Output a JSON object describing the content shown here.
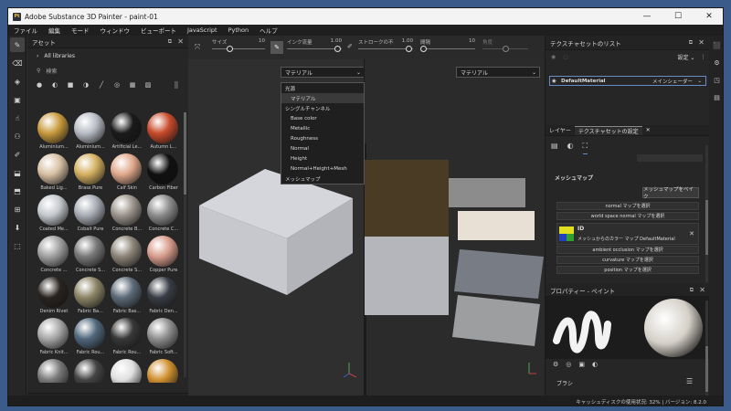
{
  "window": {
    "title": "Adobe Substance 3D Painter - paint-01",
    "app_icon": "Pt",
    "controls": [
      "—",
      "☐",
      "✕"
    ]
  },
  "menu": [
    "ファイル",
    "編集",
    "モード",
    "ウィンドウ",
    "ビューポート",
    "JavaScript",
    "Python",
    "ヘルプ"
  ],
  "toolbar": {
    "size_label": "サイズ",
    "size_value": "10",
    "flow_label": "インク流量",
    "flow_value": "1.00",
    "stroke_label": "ストロークの不",
    "stroke_value": "1.00",
    "spacing_label": "間隔",
    "spacing_value": "10",
    "angle_label": "角度",
    "brush_icon": "brush-icon"
  },
  "assets": {
    "title": "アセット",
    "library": "All libraries",
    "search_placeholder": "検索",
    "materials": [
      {
        "name": "Aluminium...",
        "color": "#c89a3c"
      },
      {
        "name": "Aluminium...",
        "color": "#b8bcc4"
      },
      {
        "name": "Artificial Le...",
        "color": "#1a1a1a"
      },
      {
        "name": "Autumn L...",
        "color": "#c84a2a"
      },
      {
        "name": "Baked Lig...",
        "color": "#d8c0a4"
      },
      {
        "name": "Brass Pure",
        "color": "#d4b060"
      },
      {
        "name": "Calf Skin",
        "color": "#e0a88c"
      },
      {
        "name": "Carbon Fiber",
        "color": "#101010"
      },
      {
        "name": "Coated Me...",
        "color": "#c4c8cc"
      },
      {
        "name": "Cobalt Pure",
        "color": "#a8acb4"
      },
      {
        "name": "Concrete B...",
        "color": "#9c948c"
      },
      {
        "name": "Concrete C...",
        "color": "#8c8c8c"
      },
      {
        "name": "Concrete ...",
        "color": "#a0a0a0"
      },
      {
        "name": "Concrete S...",
        "color": "#787878"
      },
      {
        "name": "Concrete S...",
        "color": "#8c8478"
      },
      {
        "name": "Copper Pure",
        "color": "#d89c8c"
      },
      {
        "name": "Denim Rivet",
        "color": "#2a2420"
      },
      {
        "name": "Fabric Ba...",
        "color": "#8c8466"
      },
      {
        "name": "Fabric Bas...",
        "color": "#5c6a78"
      },
      {
        "name": "Fabric Den...",
        "color": "#383c44"
      },
      {
        "name": "Fabric Knit...",
        "color": "#a8a8a8"
      },
      {
        "name": "Fabric Rou...",
        "color": "#50687c"
      },
      {
        "name": "Fabric Rou...",
        "color": "#383838"
      },
      {
        "name": "Fabric Soft...",
        "color": "#909090"
      },
      {
        "name": "",
        "color": "#7a7a7a"
      },
      {
        "name": "",
        "color": "#444444"
      },
      {
        "name": "",
        "color": "#e0e0e0"
      },
      {
        "name": "",
        "color": "#d09030"
      }
    ],
    "footer_icons": [
      "list-icon",
      "folder-icon",
      "refresh-icon",
      "new-folder-icon",
      "add-icon"
    ]
  },
  "viewport": {
    "mode_3d": "マテリアル",
    "mode_2d": "マテリアル",
    "dropdown_items": [
      {
        "label": "光源",
        "sub": false,
        "selected": false
      },
      {
        "label": "マテリアル",
        "sub": true,
        "selected": true
      },
      {
        "label": "シングルチャンネル",
        "sub": false,
        "selected": false
      },
      {
        "label": "Base color",
        "sub": true,
        "selected": false
      },
      {
        "label": "Metallic",
        "sub": true,
        "selected": false
      },
      {
        "label": "Roughness",
        "sub": true,
        "selected": false
      },
      {
        "label": "Normal",
        "sub": true,
        "selected": false
      },
      {
        "label": "Height",
        "sub": true,
        "selected": false
      },
      {
        "label": "Normal+Height+Mesh",
        "sub": true,
        "selected": false
      },
      {
        "label": "メッシュマップ",
        "sub": false,
        "selected": false
      }
    ]
  },
  "texture_sets": {
    "title": "テクスチャセットのリスト",
    "settings_label": "設定",
    "set_name": "DefaultMaterial",
    "shader": "メインシェーダー"
  },
  "settings_panel": {
    "tab_layers": "レイヤー",
    "tab_settings": "テクスチャセットの設定",
    "section": "メッシュマップ",
    "bake_button": "メッシュマップをベイク",
    "maps": [
      "normal マップを選択",
      "world space normal マップを選択"
    ],
    "id_label": "ID",
    "id_desc": "メッシュからのカラー マップ DefaultMaterial",
    "maps2": [
      "ambient occlusion マップを選択",
      "curvature マップを選択",
      "position マップを選択"
    ]
  },
  "properties": {
    "title": "プロパティー - ペイント",
    "brush_label": "ブラシ"
  },
  "status": {
    "text": "キャッシュディスクの使用状況: 32% | バージョン: 8.2.0"
  }
}
